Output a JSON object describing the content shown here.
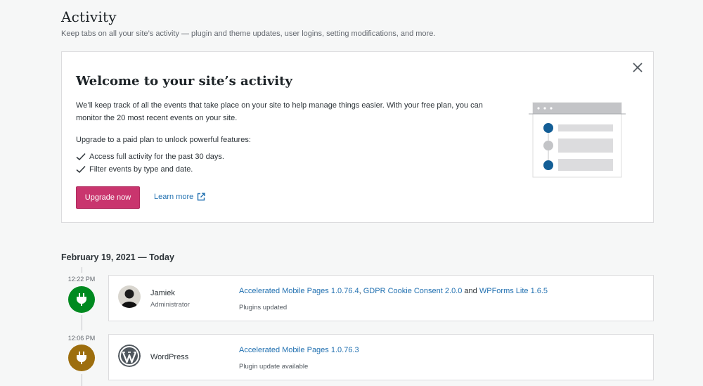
{
  "header": {
    "title": "Activity",
    "subtitle": "Keep tabs on all your site’s activity — plugin and theme updates, user logins, setting modifications, and more."
  },
  "welcome": {
    "title": "Welcome to your site’s activity",
    "description": "We’ll keep track of all the events that take place on your site to help manage things easier. With your free plan, you can monitor the 20 most recent events on your site.",
    "upgrade_text": "Upgrade to a paid plan to unlock powerful features:",
    "features": [
      "Access full activity for the past 30 days.",
      "Filter events by type and date."
    ],
    "upgrade_button": "Upgrade now",
    "learn_more": "Learn more",
    "icons": {
      "close": "close-icon",
      "check": "check-icon",
      "external": "external-link-icon"
    }
  },
  "timeline": {
    "date_heading": "February 19, 2021 — Today",
    "events": [
      {
        "time": "12:22 PM",
        "icon": "plugin-icon",
        "color": "#008a20",
        "actor_name": "Jamiek",
        "actor_role": "Administrator",
        "links": [
          "Accelerated Mobile Pages 1.0.76.4",
          "GDPR Cookie Consent 2.0.0",
          "WPForms Lite 1.6.5"
        ],
        "sep1": ", ",
        "sep2": " and ",
        "status": "Plugins updated"
      },
      {
        "time": "12:06 PM",
        "icon": "plugin-icon",
        "color": "#9d6e0e",
        "actor_name": "WordPress",
        "actor_role": "",
        "links": [
          "Accelerated Mobile Pages 1.0.76.3"
        ],
        "status": "Plugin update available"
      }
    ]
  },
  "colors": {
    "accent_pink": "#c9356e",
    "link_blue": "#2271b1",
    "success_green": "#008a20",
    "warning_gold": "#9d6e0e"
  }
}
